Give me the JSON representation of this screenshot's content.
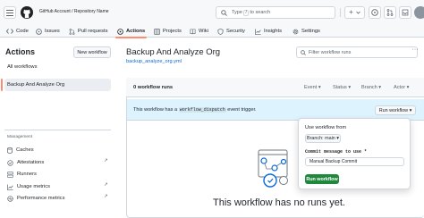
{
  "header": {
    "repo_title": "GitHub Account / Repository Name",
    "search_prefix": "Type",
    "search_key": "/",
    "search_suffix": "to search",
    "add_symbol": "+"
  },
  "tabs": [
    {
      "label": "Code"
    },
    {
      "label": "Issues"
    },
    {
      "label": "Pull requests"
    },
    {
      "label": "Actions"
    },
    {
      "label": "Projects"
    },
    {
      "label": "Wiki"
    },
    {
      "label": "Security"
    },
    {
      "label": "Insights"
    },
    {
      "label": "Settings"
    }
  ],
  "sidebar": {
    "title": "Actions",
    "new_workflow": "New workflow",
    "all_workflows": "All workflows",
    "active_workflow": "Backup And Analyze Org",
    "management_label": "Management",
    "management_items": [
      {
        "label": "Caches"
      },
      {
        "label": "Attestations"
      },
      {
        "label": "Runners"
      },
      {
        "label": "Usage metrics"
      },
      {
        "label": "Performance metrics"
      }
    ]
  },
  "main": {
    "workflow_title": "Backup And Analyze Org",
    "workflow_file": "backup_analyze_org.yml",
    "filter_placeholder": "Filter workflow runs",
    "more_symbol": "···",
    "runs_count": "0 workflow runs",
    "filters": [
      {
        "label": "Event ▾"
      },
      {
        "label": "Status ▾"
      },
      {
        "label": "Branch ▾"
      },
      {
        "label": "Actor ▾"
      }
    ],
    "dispatch_prefix": "This workflow has a",
    "dispatch_code": "workflow_dispatch",
    "dispatch_suffix": "event trigger.",
    "run_workflow_button": "Run workflow ▾",
    "empty_message": "This workflow has no runs yet."
  },
  "popover": {
    "use_workflow_from": "Use workflow from",
    "branch_button": "Branch: main ▾",
    "commit_label": "Commit message to use *",
    "commit_value": "Manual Backup Commit",
    "run_button": "Run workflow"
  },
  "colors": {
    "accent_underline": "#fd8c73",
    "primary_button": "#1f883d",
    "link": "#0969da",
    "banner": "#ddf4ff"
  }
}
